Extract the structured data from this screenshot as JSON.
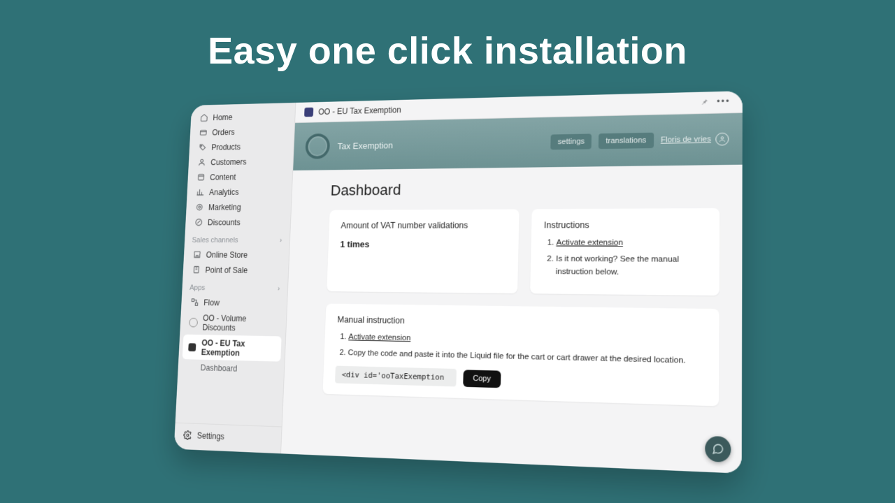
{
  "hero": "Easy one click installation",
  "sidebar": {
    "items": [
      {
        "label": "Home",
        "icon": "home"
      },
      {
        "label": "Orders",
        "icon": "orders"
      },
      {
        "label": "Products",
        "icon": "tag"
      },
      {
        "label": "Customers",
        "icon": "user"
      },
      {
        "label": "Content",
        "icon": "content"
      },
      {
        "label": "Analytics",
        "icon": "analytics"
      },
      {
        "label": "Marketing",
        "icon": "target"
      },
      {
        "label": "Discounts",
        "icon": "discount"
      }
    ],
    "sales_label": "Sales channels",
    "sales": [
      {
        "label": "Online Store",
        "icon": "store"
      },
      {
        "label": "Point of Sale",
        "icon": "pos"
      }
    ],
    "apps_label": "Apps",
    "apps": [
      {
        "label": "Flow",
        "icon": "flow"
      },
      {
        "label": "OO - Volume Discounts",
        "icon": "circle"
      },
      {
        "label": "OO - EU Tax Exemption",
        "icon": "square",
        "selected": true
      },
      {
        "label": "Dashboard",
        "sub": true
      }
    ],
    "settings": "Settings"
  },
  "crumb": {
    "app": "OO - EU Tax Exemption"
  },
  "app_header": {
    "title": "Tax Exemption",
    "settings_btn": "settings",
    "translations_btn": "translations",
    "user": "Floris de vries"
  },
  "page": {
    "title": "Dashboard"
  },
  "vat_card": {
    "title": "Amount of VAT number validations",
    "value": "1 times"
  },
  "instructions_card": {
    "title": "Instructions",
    "step1": "Activate extension",
    "step2": "Is it not working? See the manual instruction below."
  },
  "manual_card": {
    "title": "Manual instruction",
    "step1": "Activate extension",
    "step2": "Copy the code and paste it into the Liquid file for the cart or cart drawer at the desired location.",
    "code": "<div id='ooTaxExemption",
    "copy": "Copy"
  }
}
